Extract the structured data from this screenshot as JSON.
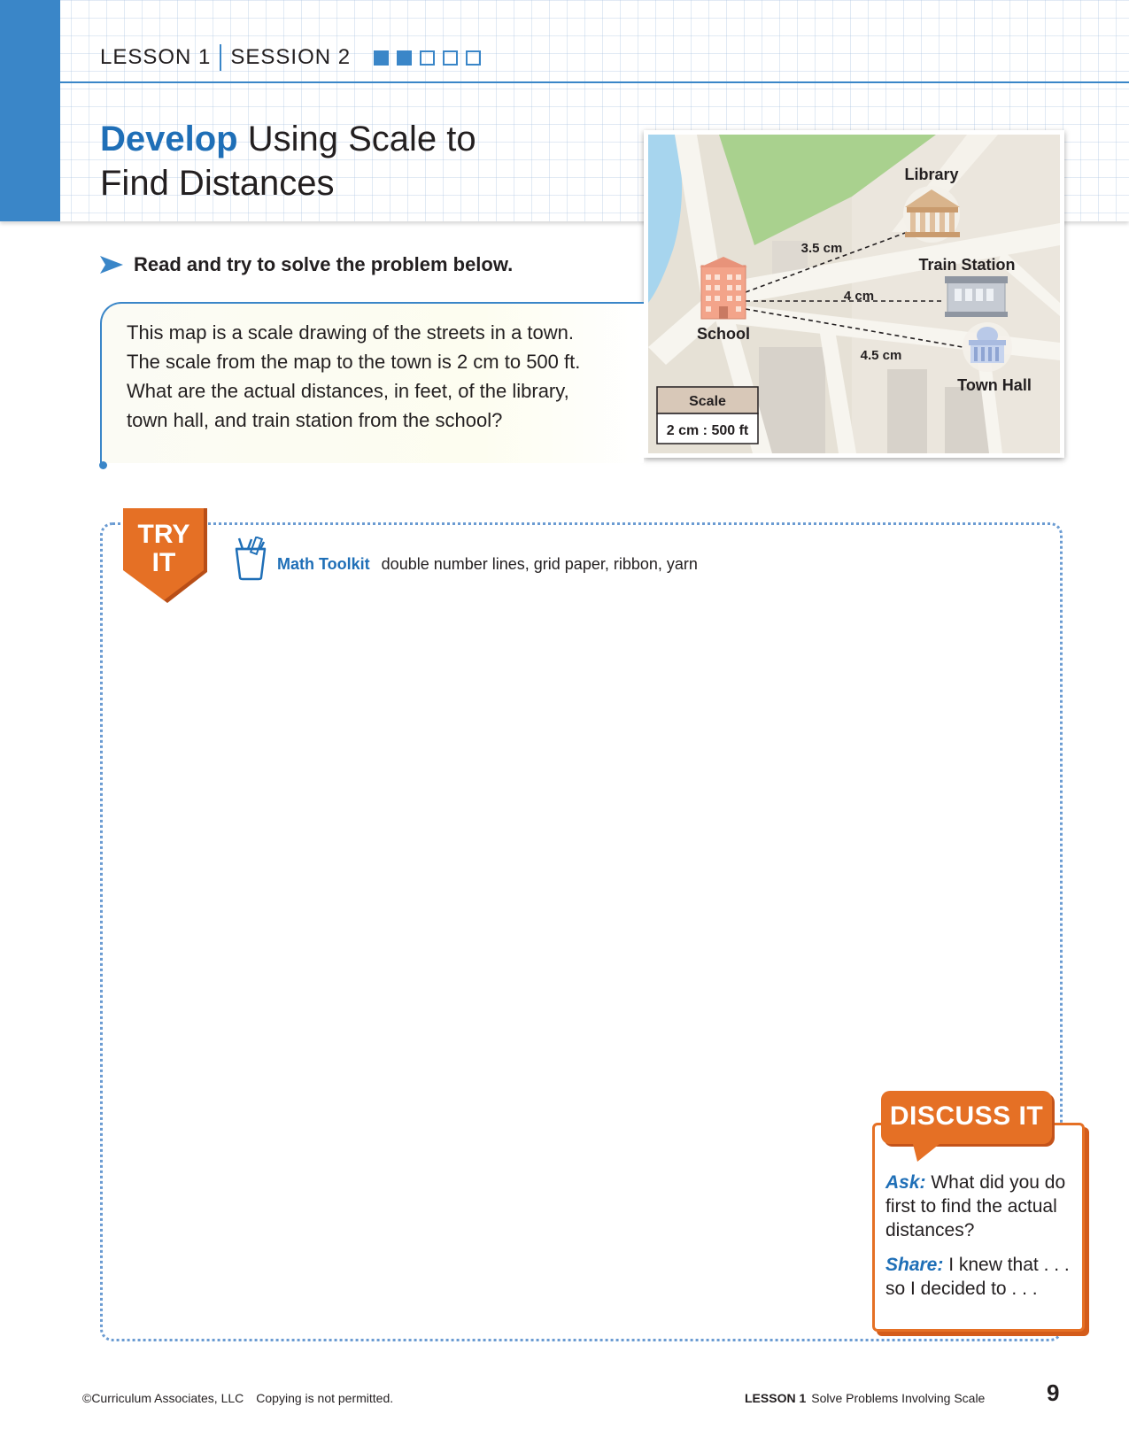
{
  "header": {
    "lesson": "LESSON 1",
    "session": "SESSION 2",
    "progress": [
      true,
      true,
      false,
      false,
      false
    ],
    "title_emphasis": "Develop",
    "title_rest_line1": " Using Scale to",
    "title_line2": "Find Distances"
  },
  "instruction": "Read and try to solve the problem below.",
  "problem": {
    "lines": [
      "This map is a scale drawing of the streets in a town.",
      "The scale from the map to the town is 2 cm to 500 ft.",
      "What are the actual distances, in feet, of the library,",
      "town hall, and train station from the school?"
    ]
  },
  "map": {
    "labels": {
      "library": "Library",
      "train_station": "Train Station",
      "school": "School",
      "town_hall": "Town Hall"
    },
    "distances": {
      "library": "3.5 cm",
      "train_station": "4 cm",
      "town_hall": "4.5 cm"
    },
    "scale_header": "Scale",
    "scale_value": "2 cm : 500 ft"
  },
  "try_it": {
    "badge_line1": "TRY",
    "badge_line2": "IT",
    "toolkit_label": "Math Toolkit",
    "toolkit_items": "double number lines, grid paper, ribbon, yarn"
  },
  "discuss": {
    "title": "DISCUSS IT",
    "ask_label": "Ask:",
    "ask_text": " What did you do first to find the actual distances?",
    "share_label": "Share:",
    "share_text": " I knew that . . . so I decided to . . ."
  },
  "footer": {
    "copyright": "©Curriculum Associates, LLC",
    "notice": "Copying is not permitted.",
    "lesson": "LESSON 1",
    "lesson_title": "Solve Problems Involving Scale",
    "page": "9"
  },
  "colors": {
    "blue": "#3a86c8",
    "title_blue": "#1f6fb7",
    "orange": "#e57025"
  }
}
